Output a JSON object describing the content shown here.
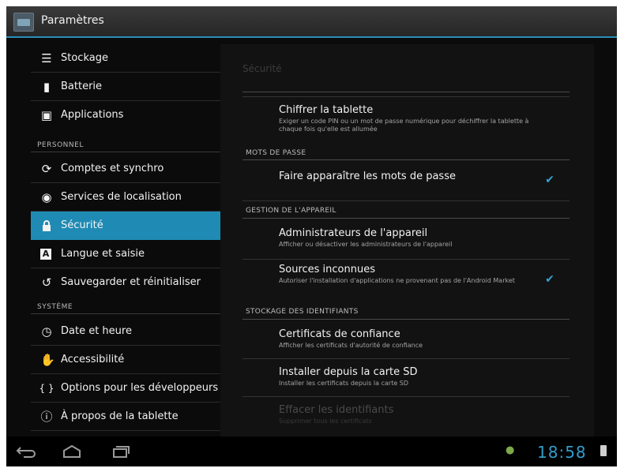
{
  "app": {
    "title": "Paramètres",
    "icon": "settings-app-icon"
  },
  "sidebar": {
    "items": [
      {
        "label": "Stockage",
        "icon": "storage-icon",
        "glyph": "☰"
      },
      {
        "label": "Batterie",
        "icon": "battery-icon",
        "glyph": "▮"
      },
      {
        "label": "Applications",
        "icon": "applications-icon",
        "glyph": "▣"
      },
      {
        "label": "Comptes et synchro",
        "icon": "sync-icon",
        "glyph": "⟳"
      },
      {
        "label": "Services de localisation",
        "icon": "location-icon",
        "glyph": "◉"
      },
      {
        "label": "Sécurité",
        "icon": "lock-icon",
        "glyph": "🔒",
        "active": true
      },
      {
        "label": "Langue et saisie",
        "icon": "keyboard-icon",
        "glyph": "A"
      },
      {
        "label": "Sauvegarder et réinitialiser",
        "icon": "backup-icon",
        "glyph": "↺"
      },
      {
        "label": "Date et heure",
        "icon": "clock-icon",
        "glyph": "◷"
      },
      {
        "label": "Accessibilité",
        "icon": "hand-icon",
        "glyph": "✋"
      },
      {
        "label": "Options pour les développeurs",
        "icon": "braces-icon",
        "glyph": "{ }"
      },
      {
        "label": "À propos de la tablette",
        "icon": "info-icon",
        "glyph": "ⓘ"
      }
    ],
    "headers": {
      "personnel": "PERSONNEL",
      "systeme": "SYSTÈME"
    }
  },
  "content": {
    "title": "Sécurité",
    "headers": {
      "passwords": "MOTS DE PASSE",
      "device_admin": "GESTION DE L'APPAREIL",
      "credential_storage": "STOCKAGE DES IDENTIFIANTS"
    },
    "prefs": {
      "encrypt": {
        "title": "Chiffrer la tablette",
        "summary": "Exiger un code PIN ou un mot de passe numérique pour déchiffrer la tablette à chaque fois qu'elle est allumée"
      },
      "show_passwords": {
        "title": "Faire apparaître les mots de passe",
        "checked": true
      },
      "device_admins": {
        "title": "Administrateurs de l'appareil",
        "summary": "Afficher ou désactiver les administrateurs de l'appareil"
      },
      "unknown_sources": {
        "title": "Sources inconnues",
        "summary": "Autoriser l'installation d'applications ne provenant pas de l'Android Market",
        "checked": true
      },
      "trusted_certs": {
        "title": "Certificats de confiance",
        "summary": "Afficher les certificats d'autorité de confiance"
      },
      "install_sd": {
        "title": "Installer depuis la carte SD",
        "summary": "Installer les certificats depuis la carte SD"
      },
      "clear_credentials": {
        "title": "Effacer les identifiants",
        "summary": "Supprimer tous les certificats",
        "disabled": true
      }
    }
  },
  "navbar": {
    "clock": "18:58",
    "colors": {
      "accent": "#1f8bb4",
      "clock": "#2f9fcc",
      "check": "#35a2d4"
    }
  }
}
